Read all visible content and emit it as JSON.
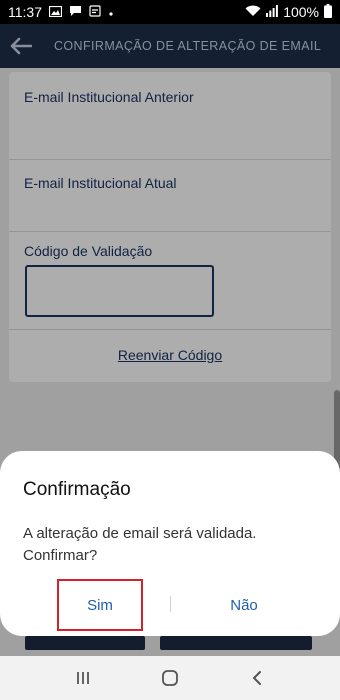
{
  "status_bar": {
    "time": "11:37",
    "battery_percent": "100%",
    "icons": [
      "gallery-icon",
      "message-icon",
      "notification-icon",
      "dot-icon",
      "wifi-icon",
      "signal-icon",
      "battery-icon"
    ]
  },
  "app_bar": {
    "title": "CONFIRMAÇÃO DE ALTERAÇÃO DE EMAIL",
    "back_icon": "back-arrow-icon"
  },
  "form": {
    "previous_email_label": "E-mail Institucional Anterior",
    "previous_email_value": "",
    "current_email_label": "E-mail Institucional Atual",
    "current_email_value": "",
    "validation_code_label": "Código de Validação",
    "validation_code_value": "",
    "resend_link": "Reenviar Código"
  },
  "dialog": {
    "title": "Confirmação",
    "message": "A alteração de email será validada. Confirmar?",
    "yes_label": "Sim",
    "no_label": "Não"
  },
  "colors": {
    "app_bar": "#1f2f4a",
    "label_text": "#1d3464",
    "dialog_button_text": "#1f5fa8",
    "highlight_box": "#d5212e"
  },
  "nav_bar": {
    "icons": [
      "recent-apps-icon",
      "home-icon",
      "back-icon"
    ]
  }
}
